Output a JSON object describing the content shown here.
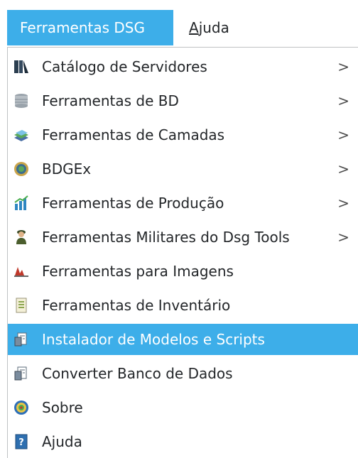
{
  "menubar": {
    "items": [
      {
        "label": "Ferramentas DSG"
      },
      {
        "label_first": "A",
        "label_rest": "juda"
      }
    ]
  },
  "menu": {
    "items": [
      {
        "label": "Catálogo de Servidores",
        "icon": "server-catalog-icon",
        "submenu": true
      },
      {
        "label": "Ferramentas de BD",
        "icon": "database-icon",
        "submenu": true
      },
      {
        "label": "Ferramentas de Camadas",
        "icon": "layers-icon",
        "submenu": true
      },
      {
        "label": "BDGEx",
        "icon": "bdgex-icon",
        "submenu": true
      },
      {
        "label": "Ferramentas de Produção",
        "icon": "production-chart-icon",
        "submenu": true
      },
      {
        "label": "Ferramentas Militares do Dsg Tools",
        "icon": "soldier-icon",
        "submenu": true
      },
      {
        "label": "Ferramentas para Imagens",
        "icon": "image-histogram-icon",
        "submenu": false
      },
      {
        "label": "Ferramentas de Inventário",
        "icon": "inventory-icon",
        "submenu": false
      },
      {
        "label": "Instalador de Modelos e Scripts",
        "icon": "installer-icon",
        "submenu": false,
        "highlighted": true
      },
      {
        "label": "Converter Banco de Dados",
        "icon": "converter-icon",
        "submenu": false
      },
      {
        "label": "Sobre",
        "icon": "about-icon",
        "submenu": false
      },
      {
        "label": "Ajuda",
        "icon": "help-icon",
        "submenu": false
      }
    ],
    "submenu_arrow": ">"
  }
}
